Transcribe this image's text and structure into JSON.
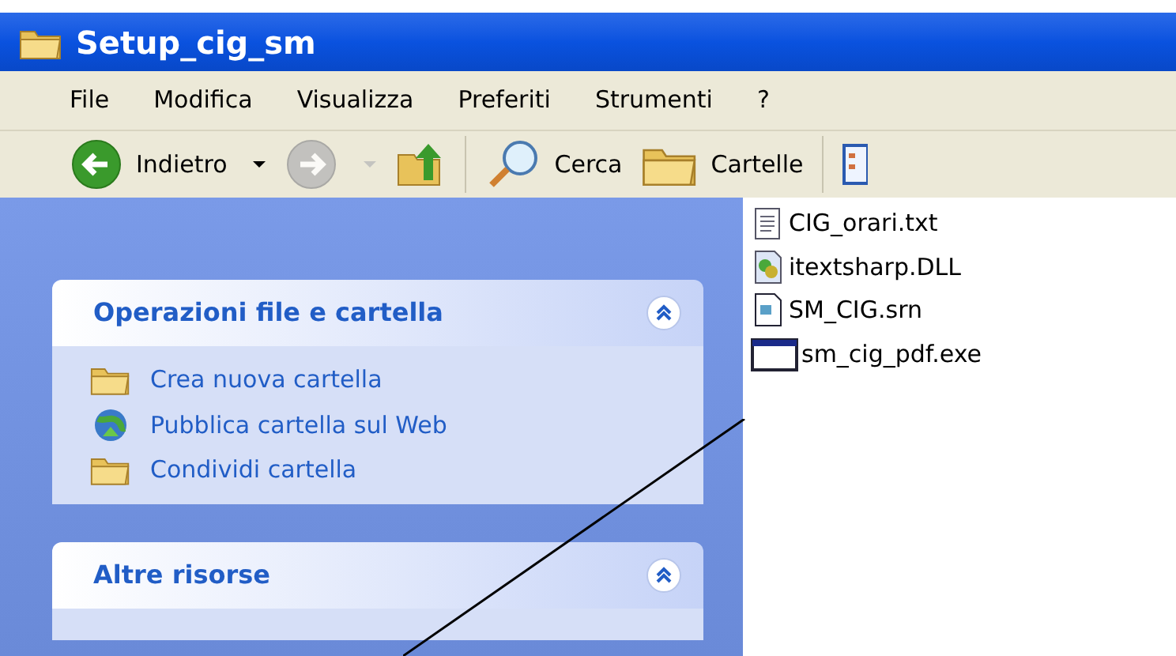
{
  "window": {
    "title": "Setup_cig_sm"
  },
  "menu": [
    "File",
    "Modifica",
    "Visualizza",
    "Preferiti",
    "Strumenti",
    "?"
  ],
  "toolbar": [
    {
      "kind": "back",
      "label": "Indietro",
      "disabled": false
    },
    {
      "kind": "forward",
      "disabled": true
    },
    {
      "kind": "up",
      "disabled": false
    },
    {
      "kind": "search",
      "label": "Cerca",
      "disabled": false
    },
    {
      "kind": "folders",
      "label": "Cartelle",
      "disabled": false
    },
    {
      "kind": "views",
      "disabled": false
    }
  ],
  "sidebar": {
    "panels": [
      {
        "title": "Operazioni file e cartella",
        "expanded": true,
        "items": [
          {
            "kind": "newfolder",
            "label": "Crea nuova cartella"
          },
          {
            "kind": "web",
            "label": "Pubblica cartella sul Web"
          },
          {
            "kind": "share",
            "label": "Condividi cartella"
          }
        ]
      },
      {
        "title": "Altre risorse",
        "expanded": true
      }
    ]
  },
  "files": [
    {
      "kind": "txt",
      "name": "CIG_orari.txt"
    },
    {
      "kind": "dll",
      "name": "itextsharp.DLL"
    },
    {
      "kind": "srn",
      "name": "SM_CIG.srn"
    },
    {
      "kind": "exe",
      "name": "sm_cig_pdf.exe"
    }
  ]
}
